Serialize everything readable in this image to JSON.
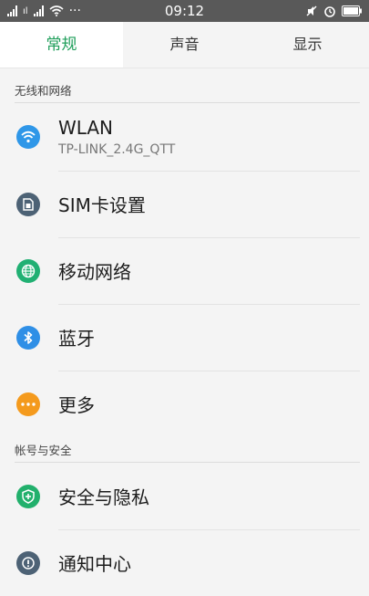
{
  "status_bar": {
    "time": "09:12",
    "more_dots": "···"
  },
  "tabs": [
    {
      "label": "常规",
      "active": true
    },
    {
      "label": "声音",
      "active": false
    },
    {
      "label": "显示",
      "active": false
    }
  ],
  "sections": [
    {
      "title": "无线和网络",
      "items": [
        {
          "label": "WLAN",
          "sub": "TP-LINK_2.4G_QTT",
          "icon": "wifi-icon",
          "color": "#2f97e8"
        },
        {
          "label": "SIM卡设置",
          "icon": "sim-card-icon",
          "color": "#4d6275"
        },
        {
          "label": "移动网络",
          "icon": "globe-icon",
          "color": "#21b073"
        },
        {
          "label": "蓝牙",
          "icon": "bluetooth-icon",
          "color": "#2f8fe6"
        },
        {
          "label": "更多",
          "icon": "more-icon",
          "color": "#f49a1d"
        }
      ]
    },
    {
      "title": "帐号与安全",
      "items": [
        {
          "label": "安全与隐私",
          "icon": "shield-icon",
          "color": "#22b06c"
        },
        {
          "label": "通知中心",
          "icon": "notification-icon",
          "color": "#4d6275"
        }
      ]
    }
  ],
  "colors": {
    "accent": "#1e9e5a",
    "status_bar": "#595959"
  }
}
